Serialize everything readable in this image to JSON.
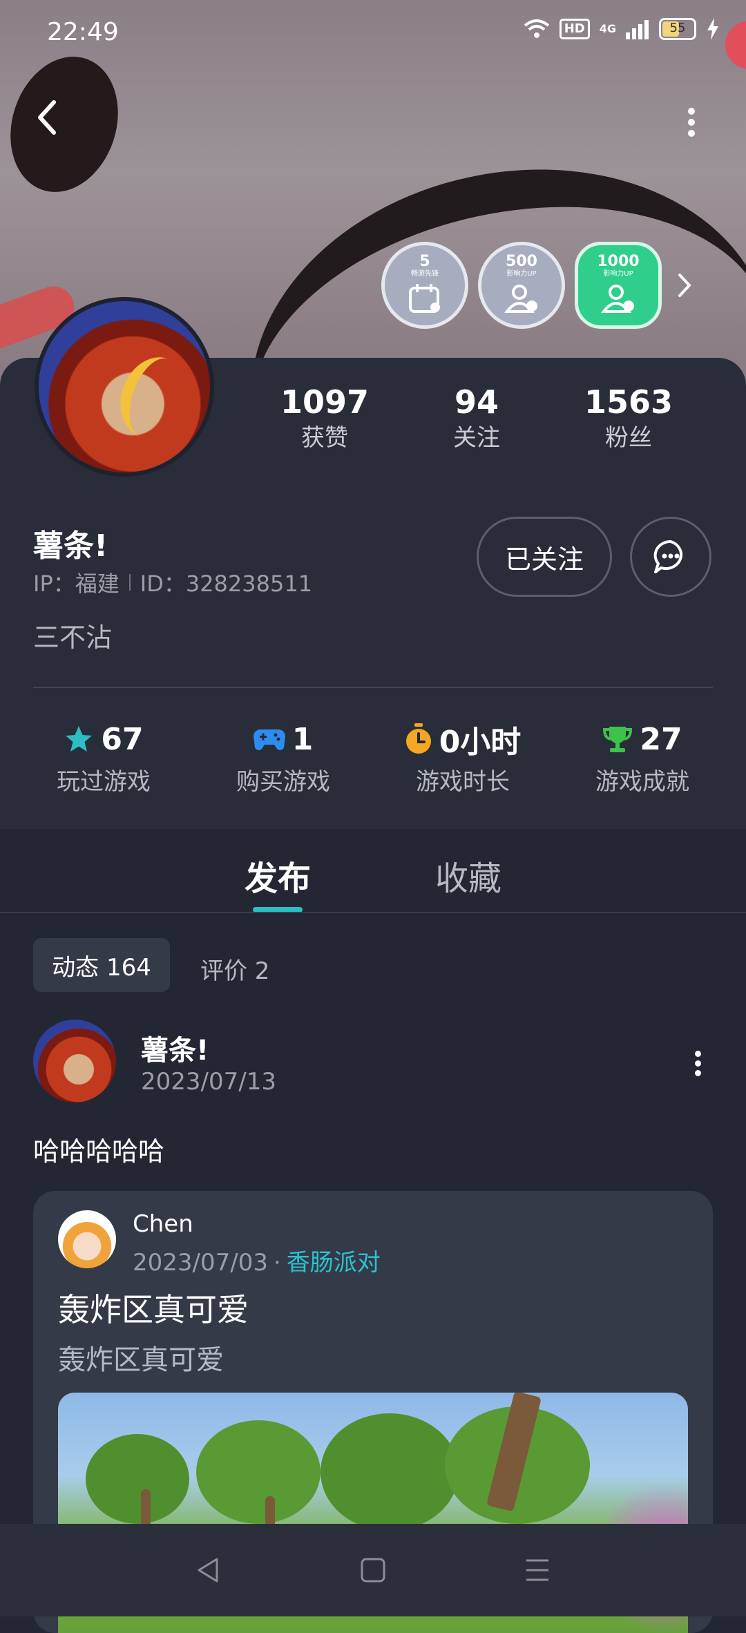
{
  "status_bar": {
    "time": "22:49",
    "hd": "HD",
    "network": "4G",
    "battery": "55",
    "battery_level": 0.55
  },
  "badges": [
    {
      "num": "5",
      "sub": "畅游先锋"
    },
    {
      "num": "500",
      "sub": "影响力UP"
    },
    {
      "num": "1000",
      "sub": "影响力UP"
    }
  ],
  "profile": {
    "stats": [
      {
        "value": "1097",
        "label": "获赞"
      },
      {
        "value": "94",
        "label": "关注"
      },
      {
        "value": "1563",
        "label": "粉丝"
      }
    ],
    "name": "薯条!",
    "ip": "IP：福建",
    "id": "ID：328238511",
    "bio": "三不沾",
    "follow_label": "已关注",
    "game_stats": [
      {
        "value": "67",
        "label": "玩过游戏",
        "icon": "star-icon",
        "color": "#2bbfc4"
      },
      {
        "value": "1",
        "label": "购买游戏",
        "icon": "gamepad-icon",
        "color": "#2d8cf0"
      },
      {
        "value": "0小时",
        "label": "游戏时长",
        "icon": "stopwatch-icon",
        "color": "#f5a623"
      },
      {
        "value": "27",
        "label": "游戏成就",
        "icon": "trophy-icon",
        "color": "#3cc34a"
      }
    ]
  },
  "tabs": {
    "active": "发布",
    "inactive": "收藏"
  },
  "sub_tabs": {
    "dynamic": "动态 164",
    "review": "评价 2"
  },
  "post": {
    "author": "薯条!",
    "date": "2023/07/13",
    "text": "哈哈哈哈哈",
    "quote": {
      "author": "Chen",
      "date": "2023/07/03",
      "dot": "·",
      "game": "香肠派对",
      "title": "轰炸区真可爱",
      "body": "轰炸区真可爱"
    }
  },
  "colors": {
    "accent": "#2bbfc4",
    "background": "#232733",
    "card": "#292d39"
  }
}
